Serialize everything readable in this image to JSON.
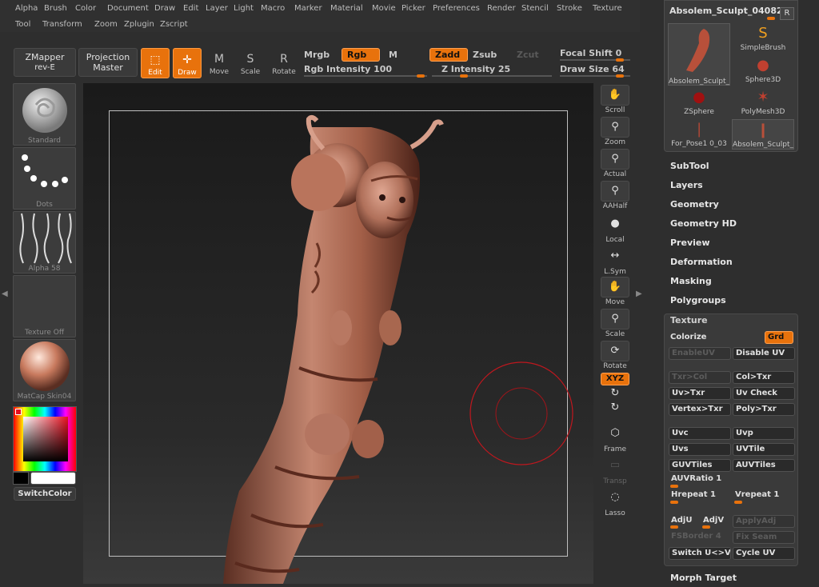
{
  "menu": {
    "row1": [
      "Alpha",
      "Brush",
      "Color",
      "Document",
      "Draw",
      "Edit",
      "Layer",
      "Light",
      "Macro",
      "Marker",
      "Material",
      "Movie",
      "Picker",
      "Preferences",
      "Render",
      "Stencil",
      "Stroke",
      "Texture"
    ],
    "row2": [
      "Tool",
      "Transform",
      "Zoom",
      "Zplugin",
      "Zscript"
    ]
  },
  "shelf": {
    "zmapper_line1": "ZMapper",
    "zmapper_line2": "rev-E",
    "projection_line1": "Projection",
    "projection_line2": "Master",
    "edit": "Edit",
    "draw": "Draw",
    "move": "Move",
    "scale": "Scale",
    "rotate": "Rotate",
    "mrgb": "Mrgb",
    "rgb": "Rgb",
    "m": "M",
    "rgb_intensity": "Rgb Intensity 100",
    "zadd": "Zadd",
    "zsub": "Zsub",
    "zcut": "Zcut",
    "z_intensity": "Z Intensity 25",
    "focal_shift": "Focal Shift 0",
    "draw_size": "Draw Size 64"
  },
  "left_tray": {
    "brush": "Standard",
    "stroke": "Dots",
    "alpha": "Alpha 58",
    "texture": "Texture Off",
    "material": "MatCap Skin04",
    "switch_color": "SwitchColor"
  },
  "right_toolbar": [
    "Scroll",
    "Zoom",
    "Actual",
    "AAHalf",
    "Local",
    "L.Sym",
    "Move",
    "Scale",
    "Rotate",
    "XYZ",
    "Frame",
    "Transp",
    "Lasso"
  ],
  "tool_panel": {
    "title": "Absolem_Sculpt_04082",
    "r_button": "R",
    "items": [
      "Absolem_Sculpt_",
      "SimpleBrush",
      "Sphere3D",
      "ZSphere",
      "PolyMesh3D",
      "For_Pose1 0_03",
      "Absolem_Sculpt_"
    ]
  },
  "sections": [
    "SubTool",
    "Layers",
    "Geometry",
    "Geometry HD",
    "Preview",
    "Deformation",
    "Masking",
    "Polygroups"
  ],
  "texture_panel": {
    "title": "Texture",
    "colorize": "Colorize",
    "grd": "Grd",
    "enable_uv": "EnableUV",
    "disable_uv": "Disable UV",
    "txr_col": "Txr>Col",
    "col_txr": "Col>Txr",
    "uv_txr": "Uv>Txr",
    "uv_check": "Uv Check",
    "vertex_txr": "Vertex>Txr",
    "poly_txr": "Poly>Txr",
    "uvc": "Uvc",
    "uvp": "Uvp",
    "uvs": "Uvs",
    "uvtile": "UVTile",
    "guvtiles": "GUVTiles",
    "auvtiles": "AUVTiles",
    "auvratio": "AUVRatio 1",
    "hrepeat": "Hrepeat 1",
    "vrepeat": "Vrepeat 1",
    "adju": "AdjU",
    "adjv": "AdjV",
    "applyadj": "ApplyAdj",
    "fsborder": "FSBorder 4",
    "fix_seam": "Fix Seam",
    "switch_uv": "Switch U<>V",
    "cycle_uv": "Cycle UV"
  },
  "morph_target": "Morph Target",
  "colors": {
    "accent": "#e8720c",
    "panel": "#3a3a3a",
    "background": "#2e2e2e",
    "model": "#b06a52"
  }
}
